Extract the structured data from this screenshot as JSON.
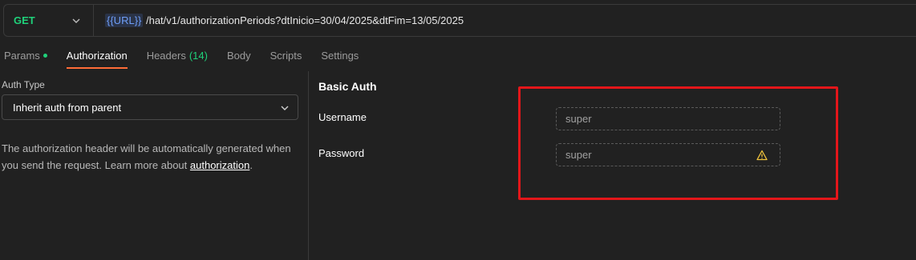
{
  "request": {
    "method": "GET",
    "url_variable": "{{URL}}",
    "url_path": " /hat/v1/authorizationPeriods?dtInicio=30/04/2025&dtFim=13/05/2025"
  },
  "tabs": {
    "params": "Params",
    "authorization": "Authorization",
    "headers": "Headers",
    "headers_count": "(14)",
    "body": "Body",
    "scripts": "Scripts",
    "settings": "Settings"
  },
  "auth": {
    "type_label": "Auth Type",
    "type_value": "Inherit auth from parent",
    "description": "The authorization header will be automatically generated when you send the request. Learn more about ",
    "link_text": "authorization",
    "description_end": "."
  },
  "basic_auth": {
    "title": "Basic Auth",
    "username_label": "Username",
    "username_value": "super",
    "password_label": "Password",
    "password_value": "super"
  },
  "colors": {
    "method": "#1fd17a",
    "accent": "#ff6c37",
    "highlight": "#e3161a",
    "warning": "#f0c33c"
  },
  "icons": {
    "method_dropdown": "chevron-down-icon",
    "auth_type_dropdown": "chevron-down-icon",
    "password_warning": "warning-icon"
  }
}
